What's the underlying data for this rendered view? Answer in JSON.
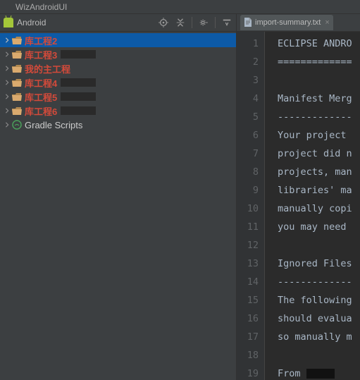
{
  "window": {
    "title": "WizAndroidUI"
  },
  "panel": {
    "title": "Android"
  },
  "tree": {
    "items": [
      {
        "label": "库工程2",
        "red": true,
        "selected": true
      },
      {
        "label": "库工程3",
        "red": true,
        "selected": false,
        "redacted": true
      },
      {
        "label": "我的主工程",
        "red": true,
        "selected": false
      },
      {
        "label": "库工程4",
        "red": true,
        "selected": false,
        "redacted": true
      },
      {
        "label": "库工程5",
        "red": true,
        "selected": false,
        "redacted": true
      },
      {
        "label": "库工程6",
        "red": true,
        "selected": false,
        "redacted": true
      }
    ],
    "gradle": "Gradle Scripts"
  },
  "tab": {
    "label": "import-summary.txt"
  },
  "editor": {
    "lines": [
      "ECLIPSE ANDRO",
      "=============",
      "",
      "Manifest Merg",
      "-------------",
      "Your project ",
      "project did n",
      "projects, man",
      "libraries' ma",
      "manually copi",
      "you may need ",
      "",
      "Ignored Files",
      "-------------",
      "The following",
      "should evalua",
      "so manually m",
      "",
      "From "
    ]
  }
}
